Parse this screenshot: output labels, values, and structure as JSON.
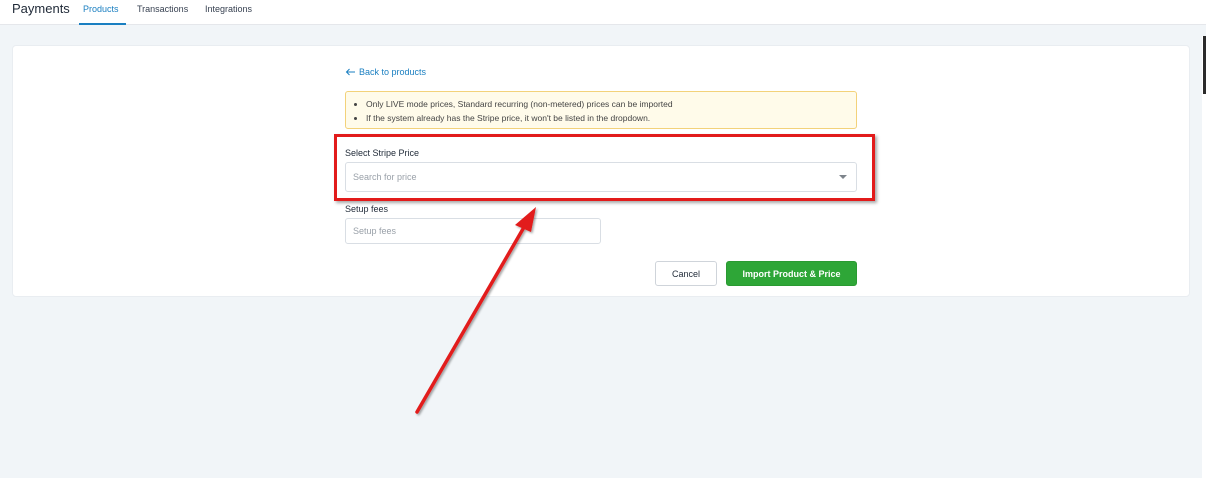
{
  "header": {
    "title": "Payments",
    "tabs": [
      {
        "label": "Products",
        "active": true
      },
      {
        "label": "Transactions",
        "active": false
      },
      {
        "label": "Integrations",
        "active": false
      }
    ]
  },
  "form": {
    "back_link": "Back to products",
    "notice": {
      "items": [
        "Only LIVE mode prices, Standard recurring (non-metered) prices can be imported",
        "If the system already has the Stripe price, it won't be listed in the dropdown."
      ]
    },
    "select_price": {
      "label": "Select Stripe Price",
      "placeholder": "Search for price"
    },
    "setup_fees": {
      "label": "Setup fees",
      "placeholder": "Setup fees",
      "value": ""
    },
    "buttons": {
      "cancel": "Cancel",
      "import": "Import Product & Price"
    }
  },
  "annotation": {
    "highlight_color": "#e21b1b"
  },
  "colors": {
    "accent": "#1a7fc1",
    "primary_button": "#2ea637",
    "notice_bg": "#fffbea",
    "notice_border": "#f3d27a"
  }
}
